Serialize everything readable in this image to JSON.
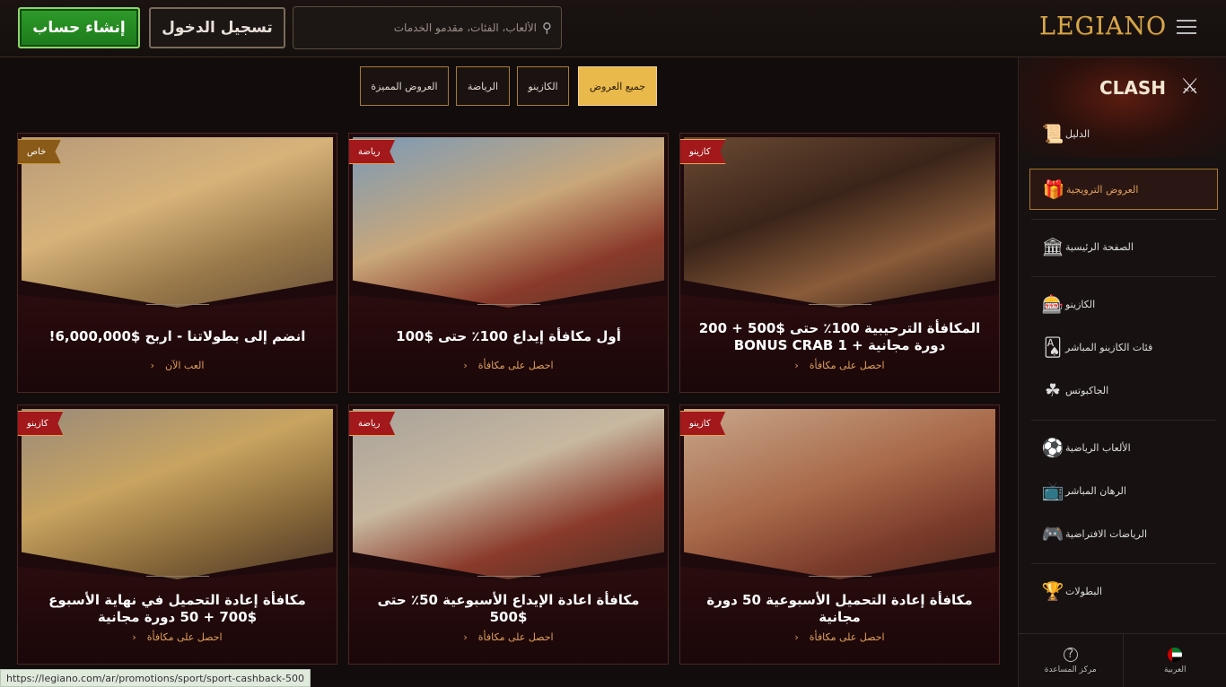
{
  "header": {
    "signup_label": "إنشاء حساب",
    "login_label": "تسجيل الدخول",
    "search_placeholder": "الألعاب، الفئات، مقدمو الخدمات",
    "logo_text": "LEGIANO"
  },
  "filters": [
    {
      "label": "جميع العروض",
      "active": true
    },
    {
      "label": "الكازينو",
      "active": false
    },
    {
      "label": "الرياضة",
      "active": false
    },
    {
      "label": "العروض المميزة",
      "active": false
    }
  ],
  "cards": [
    {
      "badge": "كازينو",
      "title": "المكافأة الترحيبية 100٪ حتى $500 + 200 دورة مجانية + 1 BONUS CRAB",
      "cta": "احصل على مكافأة",
      "scene": "gladiators"
    },
    {
      "badge": "رياضة",
      "title": "أول مكافأة إيداع 100٪ حتى $100",
      "cta": "احصل على مكافأة",
      "scene": "horse"
    },
    {
      "badge": "خاص",
      "title": "انضم إلى بطولاتنا - اربح $6,000,000!",
      "cta": "العب الآن",
      "scene": "trophy"
    },
    {
      "badge": "كازينو",
      "title": "مكافأة إعادة التحميل الأسبوعية 50 دورة مجانية",
      "cta": "احصل على مكافأة",
      "scene": "army"
    },
    {
      "badge": "رياضة",
      "title": "مكافأة اعادة الإيداع الأسبوعية 50٪ حتى $500",
      "cta": "احصل على مكافأة",
      "scene": "crown"
    },
    {
      "badge": "كازينو",
      "title": "مكافأة إعادة التحميل في نهاية الأسبوع $700 + 50 دورة مجانية",
      "cta": "احصل على مكافأة",
      "scene": "shield"
    }
  ],
  "sidebar": {
    "clash": "CLASH",
    "items": [
      {
        "label": "الدليل",
        "icon": "scroll-icon"
      },
      {
        "label": "العروض الترويجية",
        "icon": "gift-icon"
      },
      {
        "label": "الصفحة الرئيسية",
        "icon": "temple-icon"
      },
      {
        "label": "الكازينو",
        "icon": "slot-machine-icon"
      },
      {
        "label": "فئات الكازينو المباشر",
        "icon": "cards-icon"
      },
      {
        "label": "الجاكبوتس",
        "icon": "clover-icon"
      },
      {
        "label": "الألعاب الرياضية",
        "icon": "soccer-ball-icon"
      },
      {
        "label": "الرهان المباشر",
        "icon": "live-tv-icon"
      },
      {
        "label": "الرياضات الافتراضية",
        "icon": "gamepad-icon"
      },
      {
        "label": "البطولات",
        "icon": "trophy-icon"
      }
    ],
    "bottom": {
      "help_label": "مركز المساعدة",
      "lang_label": "العربية"
    }
  },
  "status_url": "https://legiano.com/ar/promotions/sport/sport-cashback-500",
  "colors": {
    "accent": "#e9b94c",
    "signup": "#2e9b2a",
    "badge_red": "#a3181a"
  }
}
